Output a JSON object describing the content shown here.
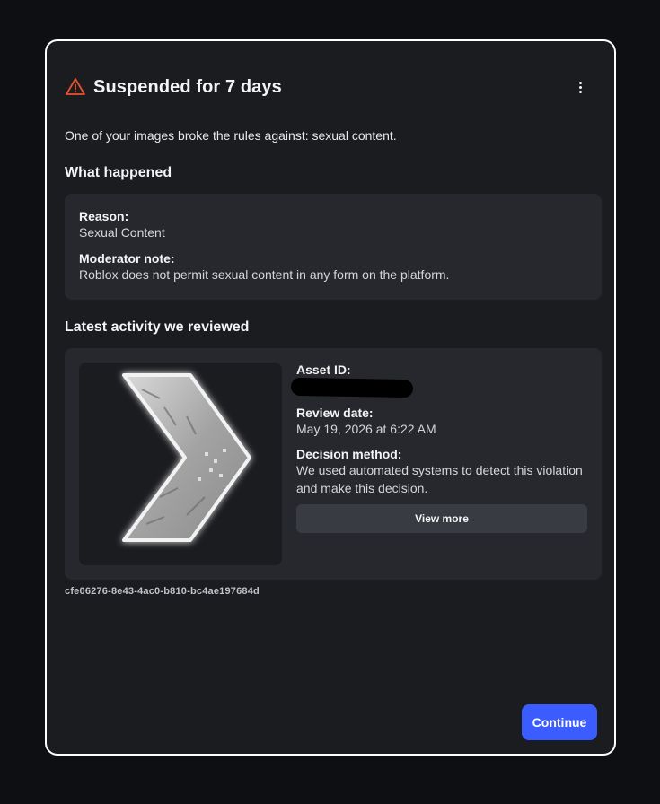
{
  "modal": {
    "title": "Suspended for 7 days",
    "title_icon": "warning-triangle-icon",
    "menu_icon": "kebab-menu-icon",
    "intro": "One of your images broke the rules against: sexual content.",
    "accent_color": "#e5532f"
  },
  "what_happened": {
    "heading": "What happened",
    "reason_label": "Reason:",
    "reason_value": "Sexual Content",
    "note_label": "Moderator note:",
    "note_value": "Roblox does not permit sexual content in any form on the platform."
  },
  "activity": {
    "heading": "Latest activity we reviewed",
    "asset_id_label": "Asset ID:",
    "review_date_label": "Review date:",
    "review_date_value": "May 19, 2026 at 6:22 AM",
    "decision_label": "Decision method:",
    "decision_value": "We used automated systems to detect this violation and make this decision.",
    "view_more_label": "View more",
    "thumbnail_icon": "chevron-right-image"
  },
  "reference_id": "cfe06276-8e43-4ac0-b810-bc4ae197684d",
  "continue_label": "Continue",
  "continue_color": "#3b5cff"
}
